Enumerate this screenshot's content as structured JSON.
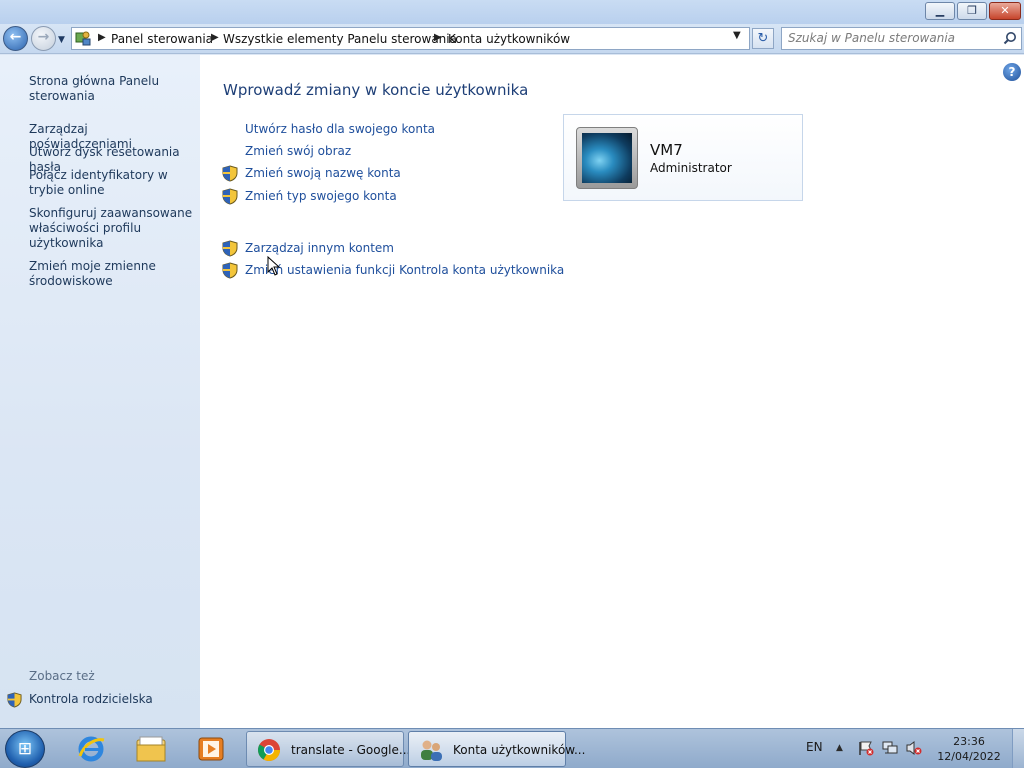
{
  "window": {
    "minimize_label": "▁",
    "maximize_label": "❐",
    "close_label": "✕"
  },
  "nav": {
    "back_glyph": "←",
    "forward_glyph": "→",
    "breadcrumbs": [
      "Panel sterowania",
      "Wszystkie elementy Panelu sterowania",
      "Konta użytkowników"
    ],
    "search_placeholder": "Szukaj w Panelu sterowania"
  },
  "sidebar": {
    "items": [
      "Strona główna Panelu sterowania",
      "Zarządzaj poświadczeniami",
      "Utwórz dysk resetowania hasła",
      "Połącz identyfikatory w trybie online",
      "Skonfiguruj zaawansowane właściwości profilu użytkownika",
      "Zmień moje zmienne środowiskowe"
    ],
    "see_also": "Zobacz też",
    "parental_controls": "Kontrola rodzicielska"
  },
  "main": {
    "title": "Wprowadź zmiany w koncie użytkownika",
    "tasks": [
      "Utwórz hasło dla swojego konta",
      "Zmień swój obraz",
      "Zmień swoją nazwę konta",
      "Zmień typ swojego konta"
    ],
    "other_tasks": [
      "Zarządzaj innym kontem",
      "Zmień ustawienia funkcji Kontrola konta użytkownika"
    ],
    "help_glyph": "?"
  },
  "user": {
    "name": "VM7",
    "role": "Administrator"
  },
  "taskbar": {
    "tasks": [
      {
        "label": "translate - Google..."
      },
      {
        "label": "Konta użytkowników..."
      }
    ],
    "language": "EN",
    "time": "23:36",
    "date": "12/04/2022"
  },
  "colors": {
    "link": "#1f4f9c",
    "title": "#1e3f77",
    "sidebar_link": "#1e395b"
  }
}
